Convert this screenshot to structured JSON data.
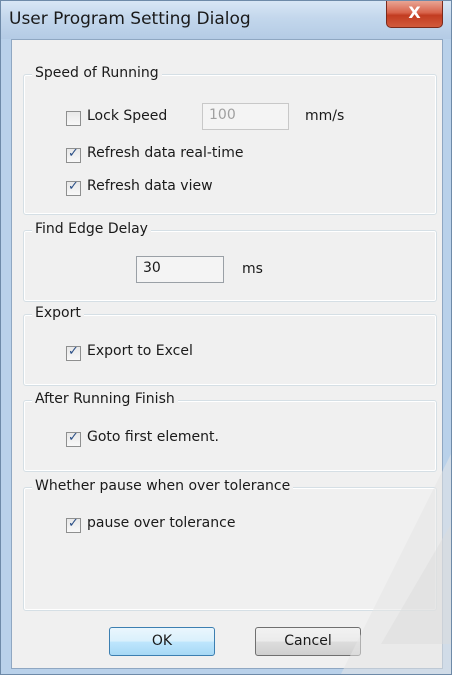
{
  "window": {
    "title": "User Program Setting Dialog",
    "close_glyph": "X"
  },
  "speed_group": {
    "title": "Speed of Running",
    "lock_speed": {
      "label": "Lock Speed",
      "checked": false
    },
    "speed_value": "100",
    "speed_unit": "mm/s",
    "refresh_realtime": {
      "label": "Refresh data real-time",
      "checked": true
    },
    "refresh_view": {
      "label": "Refresh data view",
      "checked": true
    }
  },
  "edge_group": {
    "title": "Find Edge Delay",
    "delay_value": "30",
    "delay_unit": "ms"
  },
  "export_group": {
    "title": "Export",
    "export_excel": {
      "label": "Export to Excel",
      "checked": true
    }
  },
  "finish_group": {
    "title": "After Running Finish",
    "goto_first": {
      "label": "Goto first element.",
      "checked": true
    }
  },
  "pause_group": {
    "title": "Whether pause when over tolerance",
    "pause_over": {
      "label": "pause over tolerance",
      "checked": true
    }
  },
  "buttons": {
    "ok_label": "OK",
    "cancel_label": "Cancel"
  },
  "colors": {
    "frame": "#b9d1ea",
    "client": "#f0f0f0",
    "close_button": "#c23c21",
    "checkmark": "#2b4f86"
  },
  "checkmark_glyph": "✓"
}
